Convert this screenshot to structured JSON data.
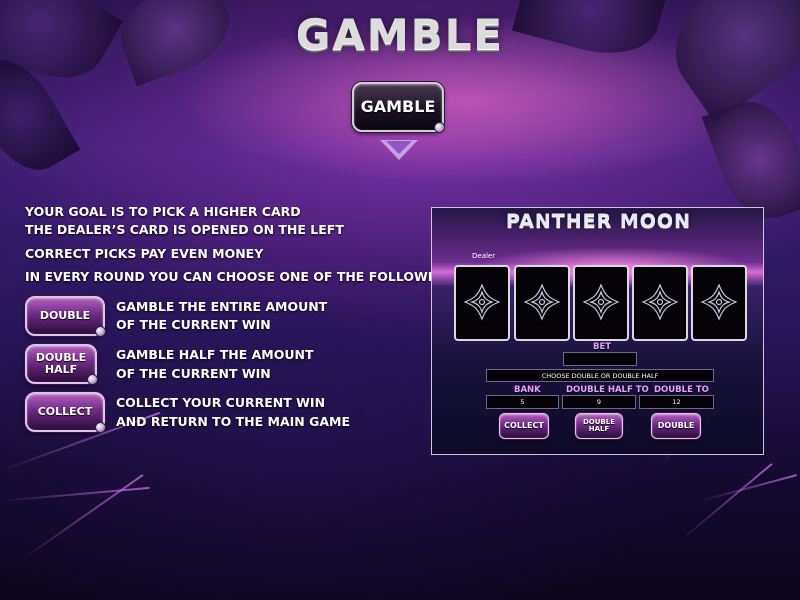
{
  "title": "GAMBLE",
  "gamble_button": {
    "label": "GAMBLE"
  },
  "instructions": [
    "YOUR GOAL IS TO PICK A HIGHER CARD",
    "THE DEALER’S CARD IS OPENED ON THE LEFT",
    "CORRECT PICKS PAY EVEN MONEY",
    "IN EVERY ROUND YOU CAN CHOOSE ONE OF THE FOLLOWING ACTIONS:"
  ],
  "actions": [
    {
      "button": "DOUBLE",
      "line1": "GAMBLE THE ENTIRE AMOUNT",
      "line2": "OF THE CURRENT WIN"
    },
    {
      "button_line1": "DOUBLE",
      "button_line2": "HALF",
      "line1": "GAMBLE HALF THE AMOUNT",
      "line2": "OF THE CURRENT WIN"
    },
    {
      "button": "COLLECT",
      "line1": "COLLECT YOUR CURRENT WIN",
      "line2": "AND RETURN TO THE MAIN GAME"
    }
  ],
  "preview": {
    "title": "PANTHER MOON",
    "dealer_label": "Dealer",
    "cards": [
      "card-back",
      "card-back",
      "card-back",
      "card-back",
      "card-back"
    ],
    "bet_label": "BET",
    "bet_value": "",
    "message": "CHOOSE DOUBLE OR DOUBLE HALF",
    "bank_label": "BANK",
    "bank_value": "5",
    "double_half_label": "DOUBLE HALF TO",
    "double_half_value": "9",
    "double_label": "DOUBLE TO",
    "double_value": "12",
    "collect_button": "COLLECT",
    "double_half_button_line1": "DOUBLE",
    "double_half_button_line2": "HALF",
    "double_button": "DOUBLE"
  },
  "colors": {
    "accent": "#8f55c0",
    "button_top": "#b45fbf",
    "button_bottom": "#2c0b3c",
    "label_pink": "#e8a0ff"
  }
}
